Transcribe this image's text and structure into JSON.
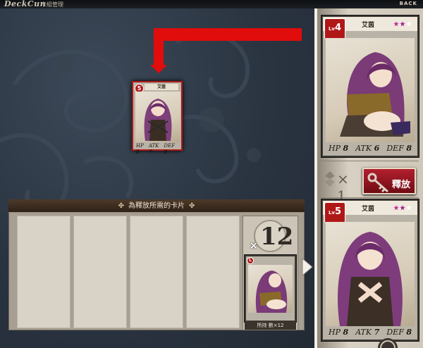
{
  "header": {
    "logo": "DeckCun",
    "subtitle": "卡組管理",
    "back_label": "BACK"
  },
  "colors": {
    "accent_red": "#e10c0c",
    "card_red": "#b01818",
    "panel_bg": "#cfc7b8"
  },
  "selected_card": {
    "level": "5",
    "name": "艾茵",
    "hp": "8",
    "atk": "7",
    "def": "8"
  },
  "top_card": {
    "level_prefix": "Lv",
    "level": "4",
    "name": "艾茵",
    "hp_label": "HP",
    "hp": "8",
    "atk_label": "ATK",
    "atk": "6",
    "def_label": "DEF",
    "def": "8"
  },
  "bottom_card": {
    "level_prefix": "Lv",
    "level": "5",
    "name": "艾茵",
    "hp_label": "HP",
    "hp": "8",
    "atk_label": "ATK",
    "atk": "7",
    "def_label": "DEF",
    "def": "8"
  },
  "release": {
    "cost_text": "× 1",
    "button_label": "釋放",
    "icon": "key-icon"
  },
  "select_panel": {
    "title": "為釋放所需的卡片",
    "deco_icon": "flourish-icon"
  },
  "stack": {
    "multiplier": "×",
    "count": "12",
    "owned_label": "所持 數×12"
  },
  "icons": {
    "next": "chevron-right-icon",
    "cost": "gem-icon",
    "emblem": "emblem-icon"
  }
}
